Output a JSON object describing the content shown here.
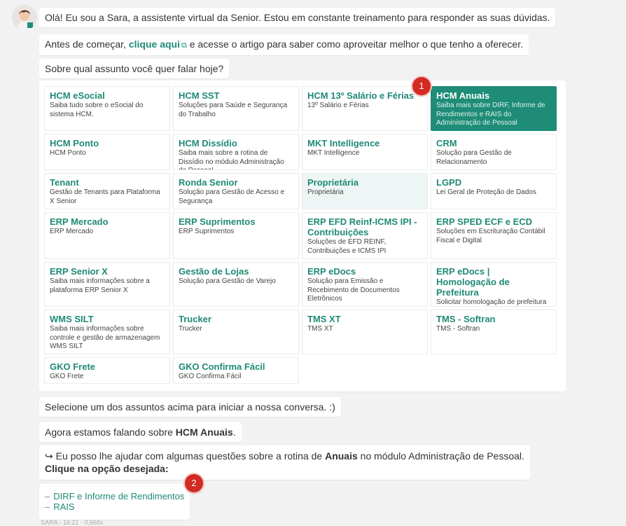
{
  "messages": {
    "greeting": "Olá! Eu sou a Sara, a assistente virtual da Senior. Estou em constante treinamento para responder as suas dúvidas.",
    "intro_prefix": "Antes de começar,",
    "intro_link": "clique aqui",
    "intro_suffix": "e acesse o artigo para saber como aproveitar melhor o que tenho a oferecer.",
    "question": "Sobre qual assunto você quer falar hoje?",
    "select_prompt": "Selecione um dos assuntos acima para iniciar a nossa conversa. :)",
    "now_talking_prefix": "Agora estamos falando sobre",
    "now_talking_topic": "HCM Anuais",
    "help_prefix": "↪ Eu posso lhe ajudar com algumas questões sobre a rotina de",
    "help_topic": "Anuais",
    "help_suffix": "no módulo Administração de Pessoal.",
    "help_cta": "Clique na opção desejada:"
  },
  "topics": [
    {
      "title": "HCM eSocial",
      "desc": "Saiba tudo sobre o eSocial do sistema HCM."
    },
    {
      "title": "HCM SST",
      "desc": "Soluções para Saúde e Segurança do Trabalho"
    },
    {
      "title": "HCM 13º Salário e Férias",
      "desc": "13º Salário e Férias"
    },
    {
      "title": "HCM Anuais",
      "desc": "Saiba mais sobre DIRF, Informe de Rendimentos e RAIS do Administração de Pessoal"
    },
    {
      "title": "HCM Ponto",
      "desc": "HCM Ponto"
    },
    {
      "title": "HCM Dissídio",
      "desc": "Saiba mais sobre a rotina de Dissídio no módulo Administração de Pessoal"
    },
    {
      "title": "MKT Intelligence",
      "desc": "MKT Intelligence"
    },
    {
      "title": "CRM",
      "desc": "Solução para Gestão de Relacionamento"
    },
    {
      "title": "Tenant",
      "desc": "Gestão de Tenants para Plataforma X Senior"
    },
    {
      "title": "Ronda Senior",
      "desc": "Solução para Gestão de Acesso e Segurança"
    },
    {
      "title": "Proprietária",
      "desc": "Proprietária"
    },
    {
      "title": "LGPD",
      "desc": "Lei Geral de Proteção de Dados"
    },
    {
      "title": "ERP Mercado",
      "desc": "ERP Mercado"
    },
    {
      "title": "ERP Suprimentos",
      "desc": "ERP Suprimentos"
    },
    {
      "title": "ERP EFD Reinf-ICMS IPI - Contribuições",
      "desc": "Soluções de EFD REINF, Contribuições e ICMS IPI"
    },
    {
      "title": "ERP SPED ECF e ECD",
      "desc": "Soluções em Escrituração Contábil Fiscal e Digital"
    },
    {
      "title": "ERP Senior X",
      "desc": "Saiba mais informações sobre a plataforma ERP Senior X"
    },
    {
      "title": "Gestão de Lojas",
      "desc": "Solução para Gestão de Varejo"
    },
    {
      "title": "ERP eDocs",
      "desc": "Solução para Emissão e Recebimento de Documentos Eletrônicos"
    },
    {
      "title": "ERP eDocs | Homologação de Prefeitura",
      "desc": "Solicitar homologação de prefeitura"
    },
    {
      "title": "WMS SILT",
      "desc": "Saiba mais informações sobre controle e gestão de armazenagem WMS SILT"
    },
    {
      "title": "Trucker",
      "desc": "Trucker"
    },
    {
      "title": "TMS XT",
      "desc": "TMS XT"
    },
    {
      "title": "TMS - Softran",
      "desc": "TMS - Softran"
    },
    {
      "title": "GKO Frete",
      "desc": "GKO Frete"
    },
    {
      "title": "GKO Confirma Fácil",
      "desc": "GKO Confirma Fácil"
    }
  ],
  "options": [
    {
      "dash": "–",
      "label": "DIRF e Informe de Rendimentos"
    },
    {
      "dash": "–",
      "label": "RAIS"
    }
  ],
  "badges": {
    "first": "1",
    "second": "2"
  },
  "footer": "SARA - 16:21 - 0,666s",
  "icons": {
    "avatar": "sara-avatar-icon",
    "external_link": "external-link-icon"
  },
  "colors": {
    "accent": "#1f8a76",
    "active_card": "#1e8c76",
    "badge": "#d32a24"
  }
}
